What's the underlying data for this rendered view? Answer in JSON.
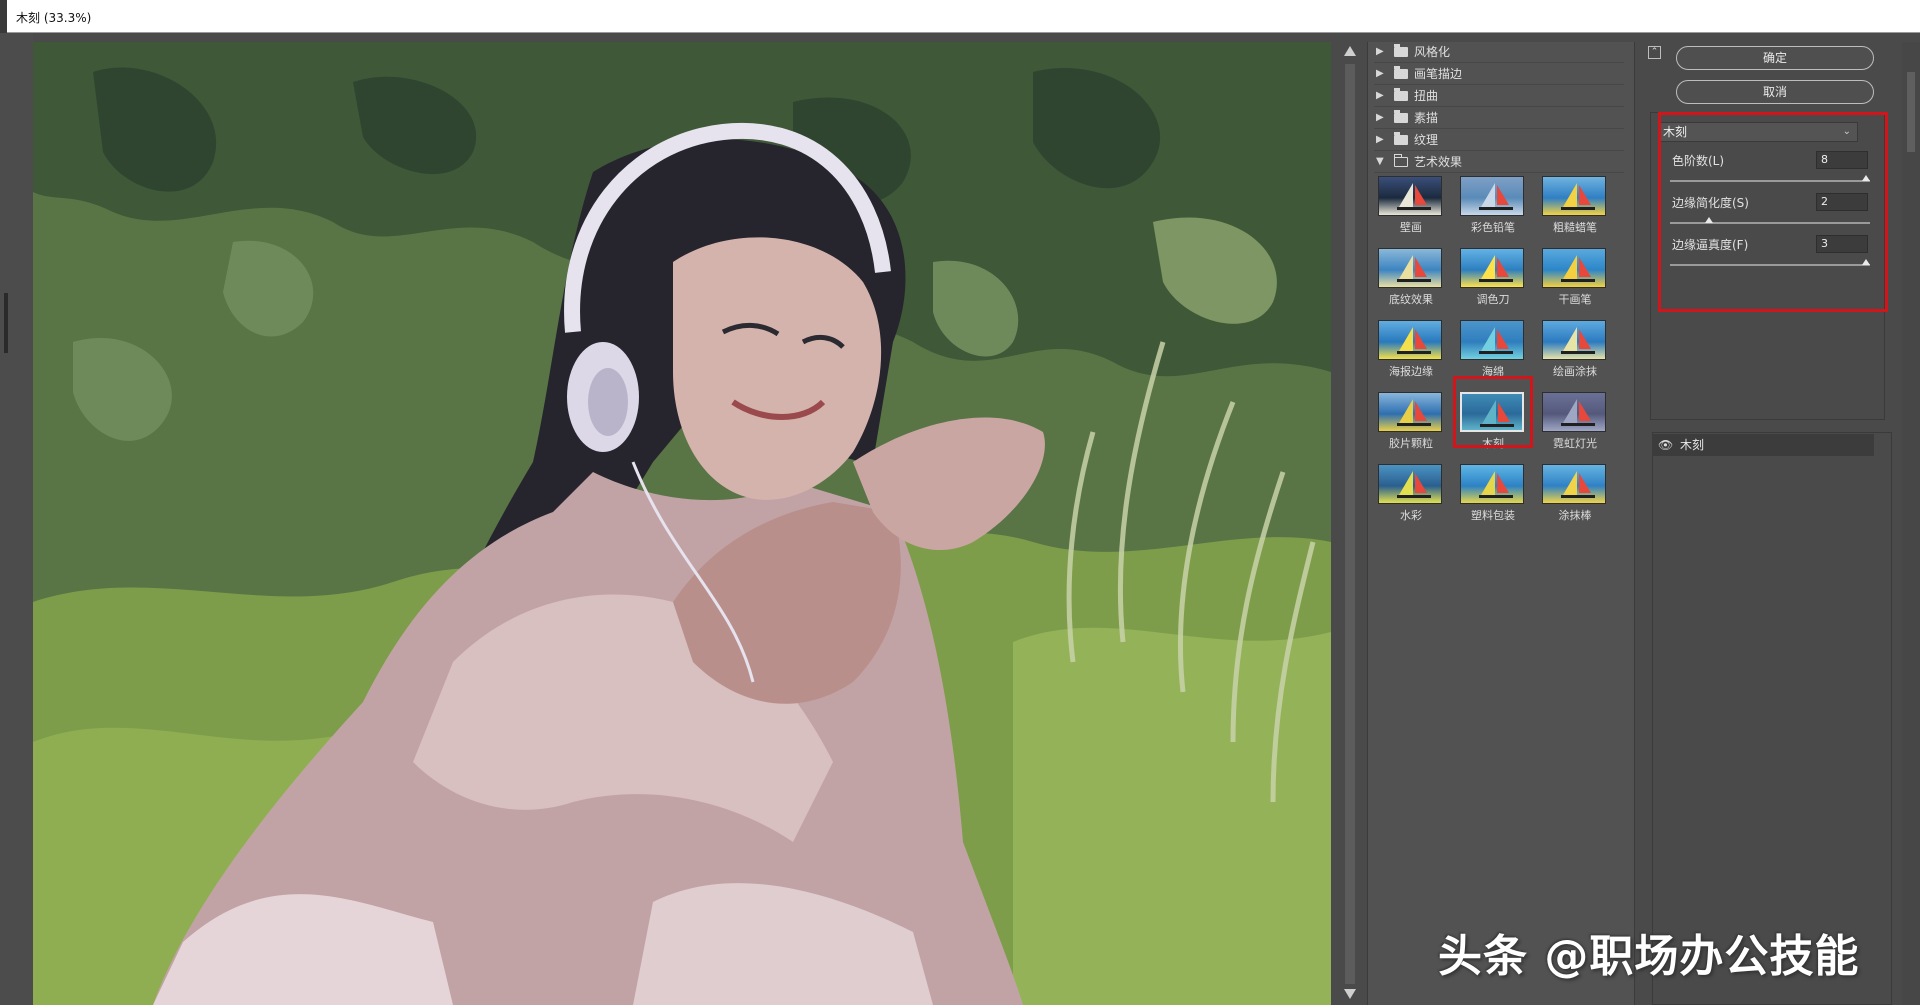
{
  "window": {
    "title": "木刻 (33.3%)"
  },
  "categories": [
    {
      "label": "风格化",
      "open": false
    },
    {
      "label": "画笔描边",
      "open": false
    },
    {
      "label": "扭曲",
      "open": false
    },
    {
      "label": "素描",
      "open": false
    },
    {
      "label": "纹理",
      "open": false
    },
    {
      "label": "艺术效果",
      "open": true
    }
  ],
  "thumbnails": [
    {
      "label": "壁画"
    },
    {
      "label": "彩色铅笔"
    },
    {
      "label": "粗糙蜡笔"
    },
    {
      "label": "底纹效果"
    },
    {
      "label": "调色刀"
    },
    {
      "label": "干画笔"
    },
    {
      "label": "海报边缘"
    },
    {
      "label": "海绵"
    },
    {
      "label": "绘画涂抹"
    },
    {
      "label": "胶片颗粒"
    },
    {
      "label": "木刻"
    },
    {
      "label": "霓虹灯光"
    },
    {
      "label": "水彩"
    },
    {
      "label": "塑料包装"
    },
    {
      "label": "涂抹棒"
    }
  ],
  "selected_thumbnail": "木刻",
  "buttons": {
    "ok": "确定",
    "cancel": "取消"
  },
  "filter_select": {
    "value": "木刻"
  },
  "params": [
    {
      "label": "色阶数(L)",
      "value": "8",
      "level": 1.0
    },
    {
      "label": "边缘简化度(S)",
      "value": "2",
      "level": 0.2
    },
    {
      "label": "边缘逼真度(F)",
      "value": "3",
      "level": 1.0
    }
  ],
  "layers": [
    {
      "name": "木刻"
    }
  ],
  "watermark": "头条 @职场办公技能",
  "colors": {
    "highlight": "#d2141b",
    "panel": "#4a4a4a"
  }
}
